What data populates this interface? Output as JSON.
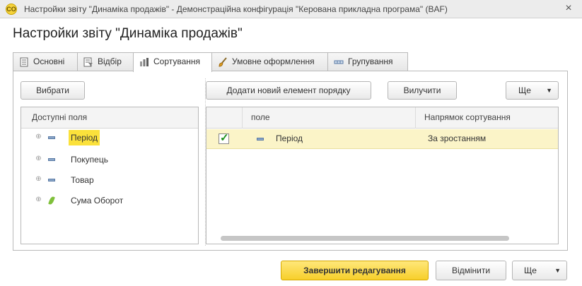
{
  "window": {
    "app_icon": "1c-logo-icon",
    "app_icon_text": "CO",
    "title": "Настройки звіту \"Динаміка продажів\" - Демонстраційна конфігурація \"Керована прикладна програма\"  (BAF)",
    "close_glyph": "×"
  },
  "form": {
    "title": "Настройки звіту \"Динаміка продажів\""
  },
  "tabs": [
    {
      "label": "Основні",
      "icon": "document-icon"
    },
    {
      "label": "Відбір",
      "icon": "filter-icon"
    },
    {
      "label": "Сортування",
      "icon": "sort-icon",
      "active": true
    },
    {
      "label": "Умовне оформлення",
      "icon": "brush-icon"
    },
    {
      "label": "Групування",
      "icon": "grouping-icon"
    }
  ],
  "left": {
    "select_button": "Вибрати",
    "tree_header": "Доступні поля",
    "fields": [
      {
        "label": "Період",
        "icon": "dimension-icon",
        "selected": true
      },
      {
        "label": "Покупець",
        "icon": "dimension-icon"
      },
      {
        "label": "Товар",
        "icon": "dimension-icon"
      },
      {
        "label": "Сума Оборот",
        "icon": "resource-icon"
      }
    ],
    "expander_glyph": "⊕"
  },
  "right": {
    "add_button": "Додати новий елемент порядку",
    "remove_button": "Вилучити",
    "more_button": "Ще",
    "columns": [
      "поле",
      "Напрямок сортування"
    ],
    "rows": [
      {
        "checked": true,
        "field": "Період",
        "direction": "За зростанням"
      }
    ],
    "check_glyph": "✓"
  },
  "footer": {
    "finish_button": "Завершити редагування",
    "cancel_button": "Відмінити",
    "more_button": "Ще"
  },
  "caret_glyph": "▼",
  "colors": {
    "accent_yellow": "#f7cf2a",
    "selection_yellow": "#fbe13b",
    "row_highlight": "#fbf4c8",
    "check_green": "#1a8f1a"
  }
}
